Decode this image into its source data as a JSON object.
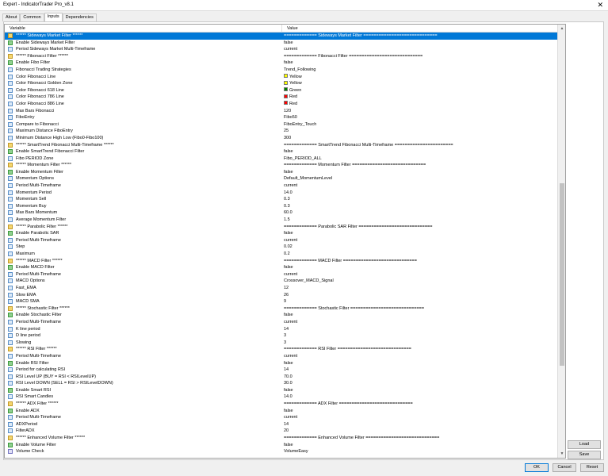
{
  "window": {
    "title": "Expert - IndicatorTrader Pro_v8.1"
  },
  "tabs": [
    {
      "label": "About"
    },
    {
      "label": "Common"
    },
    {
      "label": "Inputs",
      "active": true
    },
    {
      "label": "Dependencies"
    }
  ],
  "grid": {
    "col_variable": "Variable",
    "col_value": "Value",
    "rows": [
      {
        "name": "****** Sideways Market Filter ******",
        "value": "============= Sideways Market Filter =============================",
        "kind": "sep",
        "selected": true
      },
      {
        "name": "Enable Sideways Market Filter",
        "value": "false",
        "kind": "bool"
      },
      {
        "name": "Period Sideways Market Multi-Timeframe",
        "value": "current",
        "kind": "num"
      },
      {
        "name": "****** Fibonacci Filter ******",
        "value": "============= Fibonacci Filter =============================",
        "kind": "sep"
      },
      {
        "name": "Enable Fibo Filter",
        "value": "false",
        "kind": "bool"
      },
      {
        "name": "Fibonacci Trading Strategies",
        "value": "Trend_Following",
        "kind": "num"
      },
      {
        "name": "Color Fibonacci Line",
        "value": "Yellow",
        "kind": "color",
        "swatch": "#ffff00"
      },
      {
        "name": "Color Fibonacci Golden Zone",
        "value": "Yellow",
        "kind": "color",
        "swatch": "#ffff00"
      },
      {
        "name": "Color Fibonacci 618 Line",
        "value": "Green",
        "kind": "color",
        "swatch": "#008000"
      },
      {
        "name": "Color Fibonacci 786 Line",
        "value": "Red",
        "kind": "color",
        "swatch": "#ff0000"
      },
      {
        "name": "Color Fibonacci 886 Line",
        "value": "Red",
        "kind": "color",
        "swatch": "#ff0000"
      },
      {
        "name": "Max Bars Fibonacci",
        "value": "120",
        "kind": "num"
      },
      {
        "name": "FiboEntry",
        "value": "Fibo50",
        "kind": "num"
      },
      {
        "name": "Compare to Fibonacci",
        "value": "FiboEntry_Touch",
        "kind": "num"
      },
      {
        "name": "Maximum Distance FiboEntry",
        "value": "25",
        "kind": "num"
      },
      {
        "name": "Minimum Distance High Low (Fibo0-Fibo100)",
        "value": "300",
        "kind": "num"
      },
      {
        "name": "****** SmartTrend Fibonacci Multi-Timeframe ******",
        "value": "============= SmartTrend Fibonacci Multi-Timeframe =======================",
        "kind": "sep"
      },
      {
        "name": "Enable SmartTrend Fibonacci Filter",
        "value": "false",
        "kind": "bool"
      },
      {
        "name": "Fibo PERIOD Zone",
        "value": "Fibo_PERIOD_ALL",
        "kind": "num"
      },
      {
        "name": "****** Momentum Filter ******",
        "value": "============= Momentum Filter =============================",
        "kind": "sep"
      },
      {
        "name": "Enable Momentum Filter",
        "value": "false",
        "kind": "bool"
      },
      {
        "name": "Momentum Options",
        "value": "Default_MomentumLevel",
        "kind": "num"
      },
      {
        "name": "Period Multi-Timeframe",
        "value": "current",
        "kind": "num"
      },
      {
        "name": "Momentum Period",
        "value": "14.0",
        "kind": "num"
      },
      {
        "name": "Momentum Sell",
        "value": "0.3",
        "kind": "num"
      },
      {
        "name": "Momentum Buy",
        "value": "0.3",
        "kind": "num"
      },
      {
        "name": "Max Bars Momentum",
        "value": "60.0",
        "kind": "num"
      },
      {
        "name": "Average Momentum Filter",
        "value": "1.5",
        "kind": "num"
      },
      {
        "name": "****** Parabolic Filter ******",
        "value": "============= Parabolic SAR Filter =============================",
        "kind": "sep"
      },
      {
        "name": "Enable Parabolic SAR",
        "value": "false",
        "kind": "bool"
      },
      {
        "name": "Period Multi-Timeframe",
        "value": "current",
        "kind": "num"
      },
      {
        "name": "Step",
        "value": "0.02",
        "kind": "num"
      },
      {
        "name": "Maximum",
        "value": "0.2",
        "kind": "num"
      },
      {
        "name": "****** MACD Filter ******",
        "value": "============= MACD Filter =============================",
        "kind": "sep"
      },
      {
        "name": "Enable MACD Filter",
        "value": "false",
        "kind": "bool"
      },
      {
        "name": "Period Multi-Timeframe",
        "value": "current",
        "kind": "num"
      },
      {
        "name": "MACD Options",
        "value": "Crossover_MACD_Signal",
        "kind": "num"
      },
      {
        "name": "Fast_EMA",
        "value": "12",
        "kind": "num"
      },
      {
        "name": "Slow EMA",
        "value": "26",
        "kind": "num"
      },
      {
        "name": "MACD SMA",
        "value": "9",
        "kind": "num"
      },
      {
        "name": "****** Stochastic Filter ******",
        "value": "============= Stochastic Filter =============================",
        "kind": "sep"
      },
      {
        "name": "Enable Stochastic Filter",
        "value": "false",
        "kind": "bool"
      },
      {
        "name": "Period Multi-Timeframe",
        "value": "current",
        "kind": "num"
      },
      {
        "name": "K line period",
        "value": "14",
        "kind": "num"
      },
      {
        "name": "D line period",
        "value": "3",
        "kind": "num"
      },
      {
        "name": "Slowing",
        "value": "3",
        "kind": "num"
      },
      {
        "name": "****** RSI Filter ******",
        "value": "============= RSI Filter =============================",
        "kind": "sep"
      },
      {
        "name": "Period Multi-Timeframe",
        "value": "current",
        "kind": "num"
      },
      {
        "name": "Enable RSI Filter",
        "value": "false",
        "kind": "bool"
      },
      {
        "name": "Period for calculating RSI",
        "value": "14",
        "kind": "num"
      },
      {
        "name": "RSI Level UP (BUY = RSI < RSILevelUP)",
        "value": "70.0",
        "kind": "num"
      },
      {
        "name": "RSI Level DOWN (SELL = RSI > RSILevelDOWN)",
        "value": "30.0",
        "kind": "num"
      },
      {
        "name": "Enable Smart RSI",
        "value": "false",
        "kind": "bool"
      },
      {
        "name": "RSI Smart Candles",
        "value": "14.0",
        "kind": "num"
      },
      {
        "name": "****** ADX Filter ******",
        "value": "============= ADX Filter =============================",
        "kind": "sep"
      },
      {
        "name": "Enable ADX",
        "value": "false",
        "kind": "bool"
      },
      {
        "name": "Period Multi-Timeframe",
        "value": "current",
        "kind": "num"
      },
      {
        "name": "ADXPeriod",
        "value": "14",
        "kind": "num"
      },
      {
        "name": "FilterADX",
        "value": "20",
        "kind": "num"
      },
      {
        "name": "****** Enhanced Volume Filter ******",
        "value": "============= Enhanced Volume Filter =============================",
        "kind": "sep"
      },
      {
        "name": "Enable Volume Filter",
        "value": "false",
        "kind": "bool"
      },
      {
        "name": "Volume Check",
        "value": "VolumeEasy",
        "kind": "str"
      }
    ]
  },
  "buttons": {
    "load": "Load",
    "save": "Save",
    "ok": "OK",
    "cancel": "Cancel",
    "reset": "Reset"
  },
  "colors": {
    "selection": "#0078d7"
  }
}
